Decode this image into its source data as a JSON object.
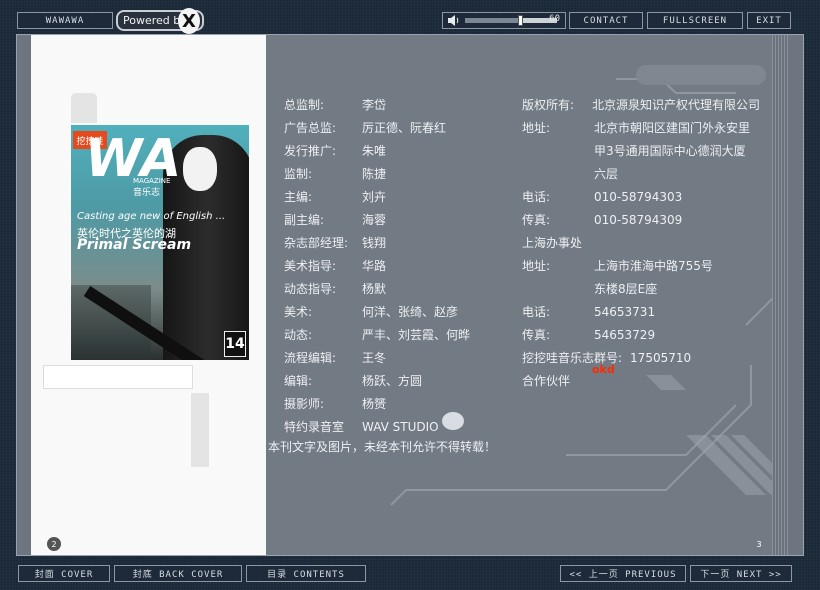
{
  "header": {
    "brand_label": "WAWAWA",
    "powered_label": "Powered by",
    "powered_mark": "X",
    "volume_value": "60",
    "volume_fraction": 0.6,
    "contact": "CONTACT",
    "fullscreen": "FULLSCREEN",
    "exit": "EXIT"
  },
  "left_page": {
    "cover_brand": "WA",
    "cover_badge": "挖挖哇",
    "cover_magazine": "MAGAZINE",
    "cover_cn": "音乐志",
    "cover_line1": "Casting age new of English ...",
    "cover_line2": "英伦时代之英伦的湖",
    "cover_line3": "Primal Scream",
    "cover_issue": "14",
    "page_number": "2"
  },
  "right_page": {
    "page_number": "3",
    "credits": [
      {
        "label": "总监制:",
        "value": "李岱"
      },
      {
        "label": "广告总监:",
        "value": "厉正德、阮春红"
      },
      {
        "label": "发行推广:",
        "value": "朱唯"
      },
      {
        "label": "监制:",
        "value": "陈捷"
      },
      {
        "label": "主编:",
        "value": "刘卉"
      },
      {
        "label": "副主编:",
        "value": "海蓉"
      },
      {
        "label": "杂志部经理:",
        "value": "钱翔"
      },
      {
        "label": "美术指导:",
        "value": "华路"
      },
      {
        "label": "动态指导:",
        "value": "杨默"
      },
      {
        "label": "美术:",
        "value": "何洋、张绮、赵彦"
      },
      {
        "label": "动态:",
        "value": "严丰、刘芸霞、何晔"
      },
      {
        "label": "流程编辑:",
        "value": "王冬"
      },
      {
        "label": "编辑:",
        "value": "杨跃、方圆"
      },
      {
        "label": "摄影师:",
        "value": "杨赟"
      },
      {
        "label": "特约录音室",
        "value": "WAV STUDIO"
      }
    ],
    "contacts": [
      {
        "label": "版权所有:",
        "value": "北京源泉知识产权代理有限公司"
      },
      {
        "label": "地址:",
        "value": "北京市朝阳区建国门外永安里"
      },
      {
        "label": "",
        "value": "甲3号通用国际中心德润大厦"
      },
      {
        "label": "",
        "value": "六层"
      },
      {
        "label": "电话:",
        "value": "010-58794303"
      },
      {
        "label": "传真:",
        "value": "010-58794309"
      },
      {
        "label": "上海办事处",
        "value": ""
      },
      {
        "label": "地址:",
        "value": "上海市淮海中路755号"
      },
      {
        "label": "",
        "value": "东楼8层E座"
      },
      {
        "label": "电话:",
        "value": "54653731"
      },
      {
        "label": "传真:",
        "value": "54653729"
      },
      {
        "label": "挖挖哇音乐志群号:",
        "value": "17505710"
      },
      {
        "label": "合作伙伴",
        "value": ""
      }
    ],
    "partner_logo": "okd",
    "notice": "本刊文字及图片，未经本刊允许不得转载！"
  },
  "footer": {
    "cover_btn": "封面 COVER",
    "back_cover_btn": "封底 BACK COVER",
    "contents_btn": "目录 CONTENTS",
    "prev_btn": "<< 上一页 PREVIOUS",
    "next_btn": "下一页 NEXT >>"
  }
}
